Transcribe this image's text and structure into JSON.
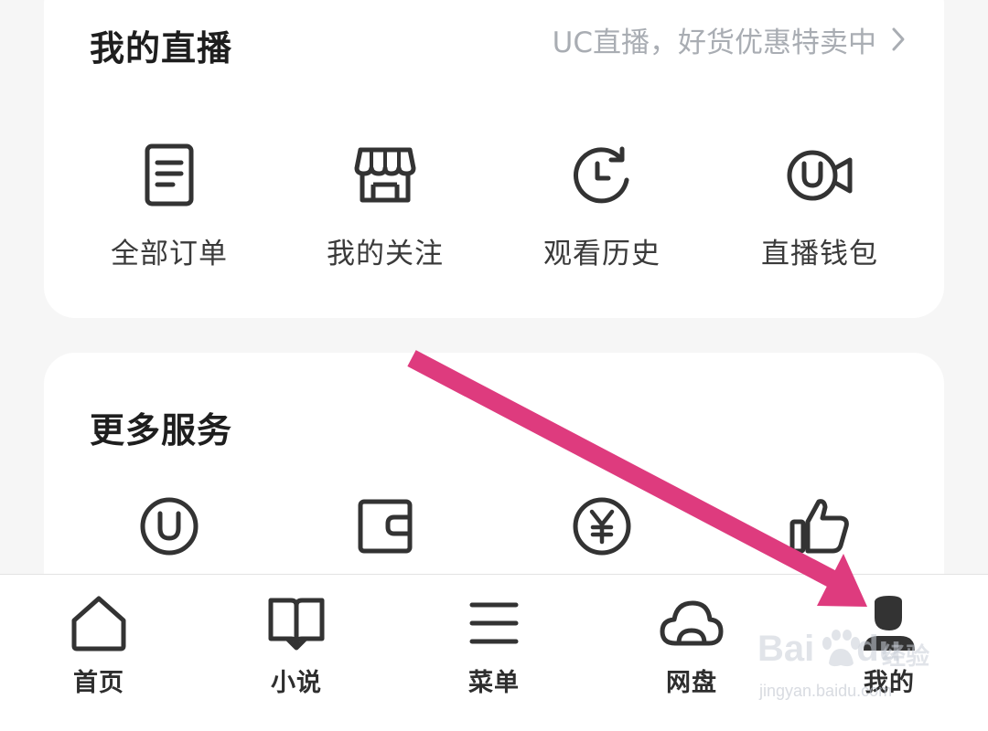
{
  "colors": {
    "background": "#f6f6f6",
    "card": "#ffffff",
    "icon_stroke": "#333333",
    "muted_text": "#a9adb3",
    "annotation_arrow": "#de3b7e"
  },
  "live_section": {
    "title": "我的直播",
    "promo_text": "UC直播，好货优惠特卖中",
    "promo_icon": "chevron-right-icon",
    "items": [
      {
        "label": "全部订单",
        "icon": "document-icon"
      },
      {
        "label": "我的关注",
        "icon": "storefront-icon"
      },
      {
        "label": "观看历史",
        "icon": "history-icon"
      },
      {
        "label": "直播钱包",
        "icon": "uc-video-icon"
      }
    ]
  },
  "more_services": {
    "title": "更多服务",
    "items": [
      {
        "icon": "uc-circle-icon"
      },
      {
        "icon": "wallet-icon"
      },
      {
        "icon": "yen-circle-icon"
      },
      {
        "icon": "thumbs-up-icon"
      }
    ]
  },
  "bottom_nav": {
    "items": [
      {
        "label": "首页",
        "icon": "home-icon"
      },
      {
        "label": "小说",
        "icon": "book-icon"
      },
      {
        "label": "菜单",
        "icon": "menu-icon"
      },
      {
        "label": "网盘",
        "icon": "cloud-icon"
      },
      {
        "label": "我的",
        "icon": "user-icon",
        "active": true
      }
    ]
  },
  "watermark": {
    "brand_left": "Bai",
    "brand_right": "du",
    "cn": "经验",
    "url": "jingyan.baidu.com"
  }
}
